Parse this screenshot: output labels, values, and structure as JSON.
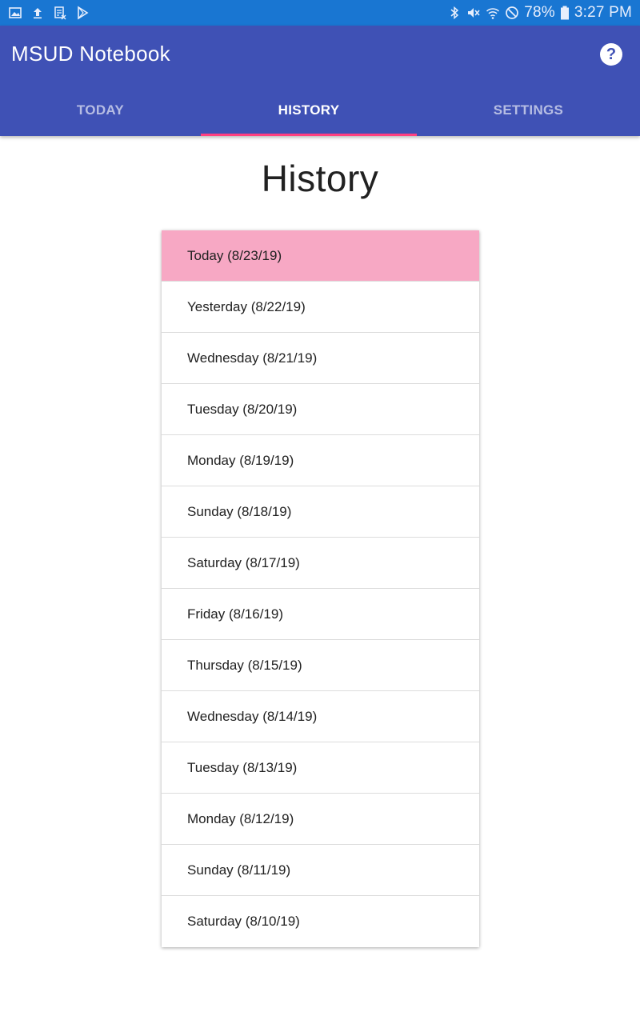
{
  "status_bar": {
    "left_icons": [
      "gallery-icon",
      "upload-icon",
      "app-notification-icon",
      "play-store-icon"
    ],
    "right_icons": [
      "bluetooth-icon",
      "mute-icon",
      "wifi-icon",
      "do-not-disturb-icon",
      "battery-icon"
    ],
    "battery": "78%",
    "time": "3:27 PM"
  },
  "app_bar": {
    "title": "MSUD Notebook",
    "help_icon": "help-icon",
    "help_label": "?",
    "color": "#3f51b5"
  },
  "tabs": [
    {
      "label": "TODAY",
      "active": false
    },
    {
      "label": "HISTORY",
      "active": true
    },
    {
      "label": "SETTINGS",
      "active": false
    }
  ],
  "accent_color": "#ff4081",
  "selected_color": "#f7a8c4",
  "main": {
    "title": "History",
    "items": [
      {
        "label": "Today (8/23/19)",
        "selected": true
      },
      {
        "label": "Yesterday (8/22/19)",
        "selected": false
      },
      {
        "label": "Wednesday (8/21/19)",
        "selected": false
      },
      {
        "label": "Tuesday (8/20/19)",
        "selected": false
      },
      {
        "label": "Monday (8/19/19)",
        "selected": false
      },
      {
        "label": "Sunday (8/18/19)",
        "selected": false
      },
      {
        "label": "Saturday (8/17/19)",
        "selected": false
      },
      {
        "label": "Friday (8/16/19)",
        "selected": false
      },
      {
        "label": "Thursday (8/15/19)",
        "selected": false
      },
      {
        "label": "Wednesday (8/14/19)",
        "selected": false
      },
      {
        "label": "Tuesday (8/13/19)",
        "selected": false
      },
      {
        "label": "Monday (8/12/19)",
        "selected": false
      },
      {
        "label": "Sunday (8/11/19)",
        "selected": false
      },
      {
        "label": "Saturday (8/10/19)",
        "selected": false
      }
    ]
  }
}
